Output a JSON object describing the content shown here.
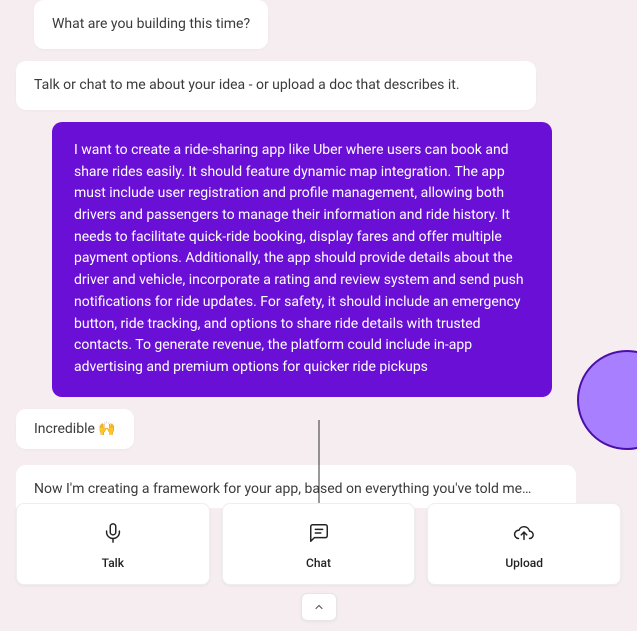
{
  "messages": {
    "bot_prompt": "What are you building this time?",
    "bot_instruction": "Talk or chat to me about your idea - or upload a doc that describes it.",
    "user_idea": "I want to create a ride-sharing app like Uber where users can book and share rides easily. It should feature dynamic map integration. The app must include user registration and profile management, allowing both drivers and passengers to manage their information and ride history. It needs to facilitate quick-ride booking, display fares and offer multiple payment options. Additionally, the app should provide details about the driver and vehicle, incorporate a rating and review system and send push notifications for ride updates. For safety, it should include an emergency button, ride tracking, and options to share ride details with trusted contacts. To generate revenue, the platform could include in-app advertising and premium options for quicker ride pickups",
    "bot_reaction": "Incredible 🙌",
    "bot_framework": "Now I'm creating a framework for your app, based on everything you've told me…"
  },
  "actions": {
    "talk": "Talk",
    "chat": "Chat",
    "upload": "Upload"
  }
}
